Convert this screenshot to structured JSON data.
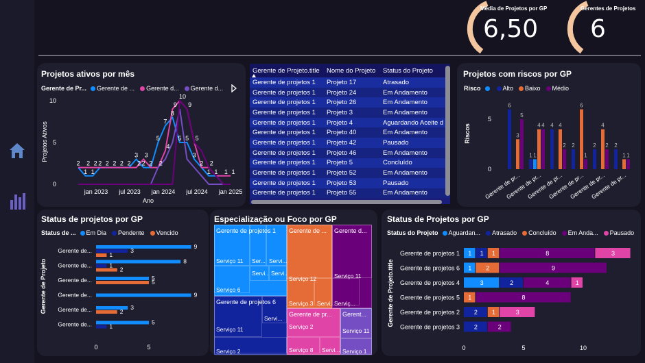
{
  "nav": {
    "home_icon": "home-icon",
    "chart_icon": "bar-chart-icon"
  },
  "kpis": [
    {
      "label": "Média de Projetos por GP",
      "value": "6,50"
    },
    {
      "label": "Gerentes de Projetos",
      "value": "6"
    }
  ],
  "colors": {
    "light_blue": "#118dff",
    "dark_blue": "#12239e",
    "orange": "#e66c37",
    "purple": "#6b007b",
    "pink": "#e044a7",
    "violet": "#744ec2",
    "gauge": "#f3c6a0"
  },
  "line_chart": {
    "title": "Projetos ativos por mês",
    "legend_title": "Gerente de Pr...",
    "legend_items": [
      "Gerente de ...",
      "Gerente d...",
      "Gerente d..."
    ],
    "ylabel": "Projetos Ativos",
    "xlabel": "Ano",
    "x_ticks": [
      "jan 2023",
      "jul 2023",
      "jan 2024",
      "jul 2024",
      "jan 2025"
    ],
    "y_ticks": [
      "0",
      "5",
      "10"
    ]
  },
  "table": {
    "headers": [
      "Gerente de Projeto.title",
      "Nome do Projeto",
      "Status do Projeto"
    ],
    "rows": [
      [
        "Gerente de projetos 1",
        "Projeto 17",
        "Atrasado"
      ],
      [
        "Gerente de projetos 1",
        "Projeto 24",
        "Em Andamento"
      ],
      [
        "Gerente de projetos 1",
        "Projeto 26",
        "Em Andamento"
      ],
      [
        "Gerente de projetos 1",
        "Projeto 3",
        "Em Andamento"
      ],
      [
        "Gerente de projetos 1",
        "Projeto 4",
        "Aguardando Aceite d"
      ],
      [
        "Gerente de projetos 1",
        "Projeto 40",
        "Em Andamento"
      ],
      [
        "Gerente de projetos 1",
        "Projeto 42",
        "Pausado"
      ],
      [
        "Gerente de projetos 1",
        "Projeto 46",
        "Em Andamento"
      ],
      [
        "Gerente de projetos 1",
        "Projeto 5",
        "Concluído"
      ],
      [
        "Gerente de projetos 1",
        "Projeto 52",
        "Em Andamento"
      ],
      [
        "Gerente de projetos 1",
        "Projeto 53",
        "Pausado"
      ],
      [
        "Gerente de projetos 1",
        "Projeto 55",
        "Em Andamento"
      ]
    ]
  },
  "risk_chart": {
    "title": "Projetos com riscos por GP",
    "legend_title": "Risco",
    "legend_items": [
      "Alto",
      "Baixo",
      "Médio"
    ],
    "ylabel": "Riscos",
    "y_ticks": [
      "0",
      "5"
    ],
    "categories": [
      "Gerente de pr...",
      "Gerente de pr...",
      "Gerente de pr...",
      "Gerente de pr...",
      "Gerente de pr...",
      "Gerente de pr..."
    ]
  },
  "status_gp": {
    "title": "Status de projetos por GP",
    "legend_title": "Status de ...",
    "legend_items": [
      "Em Dia",
      "Pendente",
      "Vencido"
    ],
    "ylabel": "Gerente de Projeto",
    "categories": [
      "Gerente de...",
      "Gerente de...",
      "Gerente de...",
      "Gerente de...",
      "Gerente de...",
      "Gerente de..."
    ],
    "x_ticks": [
      "0",
      "5"
    ]
  },
  "treemap": {
    "title": "Especialização ou Foco por GP",
    "groups": [
      {
        "label": "Gerente de projetos 1",
        "items": [
          "Serviço 11",
          "Ser...",
          "Servi...",
          "Servi...",
          "Serviço 6",
          "Servi..."
        ]
      },
      {
        "label": "Gerente de ...",
        "items": [
          "Serviço 12",
          "Serviço 3",
          "Servi..."
        ]
      },
      {
        "label": "Gerente d...",
        "items": [
          "Serviço 11",
          "Serviç..."
        ]
      },
      {
        "label": "Gerente de projetos 6",
        "items": [
          "Serviço 11",
          "Servi...",
          "Serviço 2"
        ]
      },
      {
        "label": "Gerente de pr...",
        "items": [
          "Serviço 2",
          "Serviço 8",
          "Servi..."
        ]
      },
      {
        "label": "Gerent...",
        "items": [
          "Serviço 11",
          "Serviço 1"
        ]
      }
    ]
  },
  "status_projects": {
    "title": "Status de Projetos por GP",
    "legend_title": "Status do Projeto",
    "legend_items": [
      "Aguardan...",
      "Atrasado",
      "Concluído",
      "Em Anda...",
      "Pausado"
    ],
    "ylabel": "Gerente de Projeto.title",
    "categories": [
      "Gerente de projetos 1",
      "Gerente de projetos 6",
      "Gerente de projetos 4",
      "Gerente de projetos 5",
      "Gerente de projetos 2",
      "Gerente de projetos 3"
    ],
    "x_ticks": [
      "0",
      "5",
      "10"
    ]
  },
  "chart_data": [
    {
      "type": "line",
      "title": "Projetos ativos por mês",
      "xlabel": "Ano",
      "ylabel": "Projetos Ativos",
      "ylim": [
        0,
        10
      ],
      "x_ticks": [
        "jan 2023",
        "jul 2023",
        "jan 2024",
        "jul 2024",
        "jan 2025"
      ],
      "series": [
        {
          "name": "Gerente de ...",
          "color": "#118dff",
          "values": [
            2,
            1,
            1,
            2,
            2,
            2,
            2,
            2,
            3,
            2,
            2,
            5,
            7,
            8,
            5,
            5,
            3,
            2,
            1,
            1,
            0,
            0
          ]
        },
        {
          "name": "Gerente d...",
          "color": "#e044a7",
          "values": [
            2,
            2,
            2,
            2,
            2,
            2,
            2,
            2,
            2,
            3,
            2,
            2,
            4,
            9,
            10,
            9,
            5,
            2,
            2,
            1,
            1,
            1
          ]
        },
        {
          "name": "Gerente d...",
          "color": "#744ec2",
          "values": [
            0,
            0,
            0,
            0,
            0,
            0,
            0,
            0,
            0,
            0,
            0,
            2,
            3,
            5,
            9,
            3,
            2,
            1,
            0,
            0,
            0,
            0
          ]
        },
        {
          "name": "",
          "color": "#6b007b",
          "values": [
            0,
            0,
            0,
            0,
            0,
            0,
            0,
            0,
            0,
            0,
            0,
            0,
            0,
            0,
            10,
            9,
            5,
            4,
            2,
            1,
            0,
            0
          ]
        }
      ]
    },
    {
      "type": "bar",
      "title": "Projetos com riscos por GP",
      "ylabel": "Riscos",
      "ylim": [
        0,
        7
      ],
      "categories": [
        "Gerente de pr...",
        "Gerente de pr...",
        "Gerente de pr...",
        "Gerente de pr...",
        "Gerente de pr...",
        "Gerente de pr..."
      ],
      "series": [
        {
          "name": "Alto",
          "color": "#12239e",
          "values": [
            6,
            1,
            4,
            2,
            2,
            2
          ]
        },
        {
          "name": "Baixo",
          "color": "#e66c37",
          "values": [
            3,
            4,
            4,
            6,
            4,
            1
          ]
        },
        {
          "name": "Médio",
          "color": "#6b007b",
          "values": [
            5,
            4,
            2,
            1,
            2,
            1
          ]
        }
      ],
      "extra_series_light": [
        0,
        1,
        0,
        0,
        0,
        0
      ]
    },
    {
      "type": "bar",
      "title": "Status de projetos por GP",
      "orientation": "horizontal",
      "categories": [
        "Gerente de...",
        "Gerente de...",
        "Gerente de...",
        "Gerente de...",
        "Gerente de...",
        "Gerente de..."
      ],
      "series": [
        {
          "name": "Em Dia",
          "color": "#118dff",
          "values": [
            9,
            8,
            5,
            9,
            3,
            5
          ]
        },
        {
          "name": "Pendente",
          "color": "#12239e",
          "values": [
            3,
            1,
            0,
            0,
            0,
            1
          ]
        },
        {
          "name": "Vencido",
          "color": "#e66c37",
          "values": [
            1,
            2,
            5,
            0,
            2,
            0
          ]
        }
      ]
    },
    {
      "type": "bar",
      "title": "Status de Projetos por GP",
      "orientation": "horizontal-stacked",
      "categories": [
        "Gerente de projetos 1",
        "Gerente de projetos 6",
        "Gerente de projetos 4",
        "Gerente de projetos 5",
        "Gerente de projetos 2",
        "Gerente de projetos 3"
      ],
      "series": [
        {
          "name": "Aguardan...",
          "color": "#118dff",
          "values": [
            1,
            1,
            3,
            0,
            0,
            0
          ]
        },
        {
          "name": "Atrasado",
          "color": "#12239e",
          "values": [
            1,
            0,
            2,
            0,
            2,
            2
          ]
        },
        {
          "name": "Concluído",
          "color": "#e66c37",
          "values": [
            1,
            2,
            0,
            1,
            1,
            0
          ]
        },
        {
          "name": "Em Anda...",
          "color": "#6b007b",
          "values": [
            8,
            9,
            4,
            8,
            0,
            2
          ]
        },
        {
          "name": "Pausado",
          "color": "#e044a7",
          "values": [
            3,
            0,
            1,
            0,
            3,
            0
          ]
        }
      ]
    }
  ]
}
